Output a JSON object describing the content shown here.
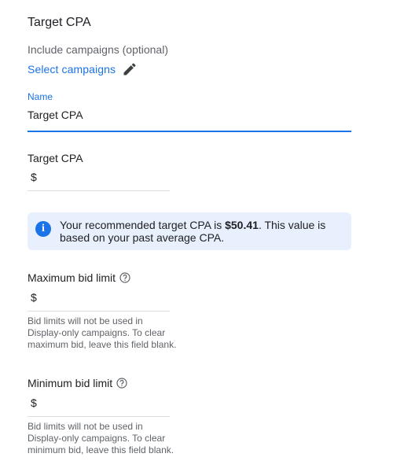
{
  "title": "Target CPA",
  "include": {
    "label": "Include campaigns (optional)",
    "link": "Select campaigns"
  },
  "name_field": {
    "label": "Name",
    "value": "Target CPA"
  },
  "target_cpa": {
    "label": "Target CPA",
    "currency": "$",
    "value": ""
  },
  "info": {
    "text_before": "Your recommended target CPA is ",
    "amount": "$50.41",
    "text_after": ". This value is based on your past average CPA.",
    "icon": "info-icon"
  },
  "max_bid": {
    "label": "Maximum bid limit",
    "currency": "$",
    "value": "",
    "hint": "Bid limits will not be used in Display-only campaigns. To clear maximum bid, leave this field blank."
  },
  "min_bid": {
    "label": "Minimum bid limit",
    "currency": "$",
    "value": "",
    "hint": "Bid limits will not be used in Display-only campaigns. To clear minimum bid, leave this field blank."
  },
  "colors": {
    "accent": "#1a73e8",
    "info_bg": "#e8f0fe",
    "secondary_text": "#5f6368"
  }
}
